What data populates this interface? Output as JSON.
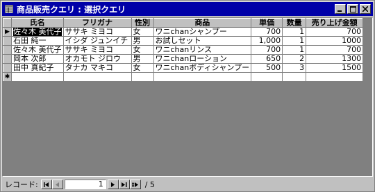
{
  "window": {
    "title": "商品販売クエリ : 選択クエリ"
  },
  "columns": [
    "氏名",
    "フリガナ",
    "性別",
    "商品",
    "単価",
    "数量",
    "売り上げ金額"
  ],
  "rows": [
    [
      "佐々木 美代子",
      "ササキ ミヨコ",
      "女",
      "ワニchanシャンプー",
      "700",
      "1",
      "700"
    ],
    [
      "石田 純一",
      "イシダ ジュンイチ",
      "男",
      "お試しセット",
      "1,000",
      "1",
      "1000"
    ],
    [
      "佐々木 美代子",
      "ササキ ミヨコ",
      "女",
      "ワニchanリンス",
      "700",
      "1",
      "700"
    ],
    [
      "岡本 次郎",
      "オカモト ジロウ",
      "男",
      "ワニchanローション",
      "650",
      "2",
      "1300"
    ],
    [
      "田中 真紀子",
      "タナカ マキコ",
      "女",
      "ワニchanボディシャンプー",
      "500",
      "3",
      "1500"
    ]
  ],
  "new_row_marker": "✱",
  "current_row_marker": "▶",
  "nav": {
    "label": "レコード:",
    "current": "1",
    "total_label": "/ 5"
  },
  "icons": {
    "app": "query-icon",
    "minimize": "minimize-icon",
    "maximize": "maximize-icon",
    "close": "close-icon"
  }
}
